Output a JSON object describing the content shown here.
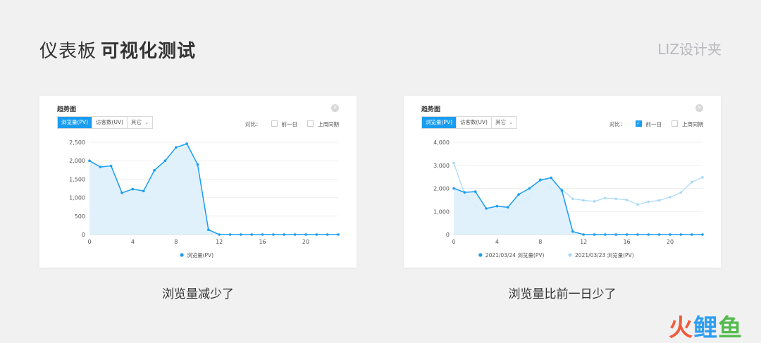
{
  "header": {
    "title_regular": "仪表板",
    "title_bold": "可视化测试",
    "brand": "LIZ设计夹"
  },
  "logo": {
    "chars": [
      "火",
      "鲤",
      "鱼"
    ]
  },
  "panels": [
    {
      "title": "趋势图",
      "tabs": [
        "浏览量(PV)",
        "访客数(UV)",
        "其它"
      ],
      "compare": {
        "label": "对比：",
        "options": [
          {
            "label": "前一日",
            "checked": false
          },
          {
            "label": "上周同期",
            "checked": false
          }
        ]
      },
      "caption": "浏览量减少了"
    },
    {
      "title": "趋势图",
      "tabs": [
        "浏览量(PV)",
        "访客数(UV)",
        "其它"
      ],
      "compare": {
        "label": "对比：",
        "options": [
          {
            "label": "前一日",
            "checked": true
          },
          {
            "label": "上周同期",
            "checked": false
          }
        ]
      },
      "caption": "浏览量比前一日少了"
    }
  ],
  "chart_data": [
    {
      "type": "area",
      "x": [
        0,
        1,
        2,
        3,
        4,
        5,
        6,
        7,
        8,
        9,
        10,
        11,
        12,
        13,
        14,
        15,
        16,
        17,
        18,
        19,
        20,
        21,
        22,
        23
      ],
      "xticks": [
        0,
        4,
        8,
        12,
        16,
        20
      ],
      "yticks": [
        "0",
        "500",
        "1,000",
        "1,500",
        "2,000",
        "2,500"
      ],
      "ylim": [
        0,
        2500
      ],
      "colors": {
        "primary": "#1a9df0",
        "fill": "#ddeffc",
        "secondary": "#a9d9f7"
      },
      "series": [
        {
          "name": "浏览量(PV)",
          "values": [
            2000,
            1830,
            1860,
            1130,
            1230,
            1180,
            1740,
            2000,
            2360,
            2460,
            1900,
            130,
            0,
            0,
            0,
            0,
            0,
            0,
            0,
            0,
            0,
            0,
            0,
            0
          ]
        }
      ]
    },
    {
      "type": "area",
      "x": [
        0,
        1,
        2,
        3,
        4,
        5,
        6,
        7,
        8,
        9,
        10,
        11,
        12,
        13,
        14,
        15,
        16,
        17,
        18,
        19,
        20,
        21,
        22,
        23
      ],
      "xticks": [
        0,
        4,
        8,
        12,
        16,
        20
      ],
      "yticks": [
        "0",
        "1,000",
        "2,000",
        "3,000",
        "4,000"
      ],
      "ylim": [
        0,
        4000
      ],
      "colors": {
        "primary": "#1a9df0",
        "fill": "#ddeffc",
        "secondary": "#a9d9f7"
      },
      "series": [
        {
          "name": "2021/03/24 浏览量(PV)",
          "values": [
            2000,
            1830,
            1860,
            1130,
            1230,
            1180,
            1740,
            2000,
            2360,
            2460,
            1900,
            130,
            0,
            0,
            0,
            0,
            0,
            0,
            0,
            0,
            0,
            0,
            0,
            0
          ]
        },
        {
          "name": "2021/03/23 浏览量(PV)",
          "values": [
            3100,
            1750,
            1250,
            950,
            960,
            980,
            1400,
            1600,
            2400,
            2000,
            1950,
            1550,
            1480,
            1440,
            1580,
            1550,
            1500,
            1300,
            1420,
            1480,
            1620,
            1820,
            2270,
            2480
          ]
        }
      ]
    }
  ]
}
